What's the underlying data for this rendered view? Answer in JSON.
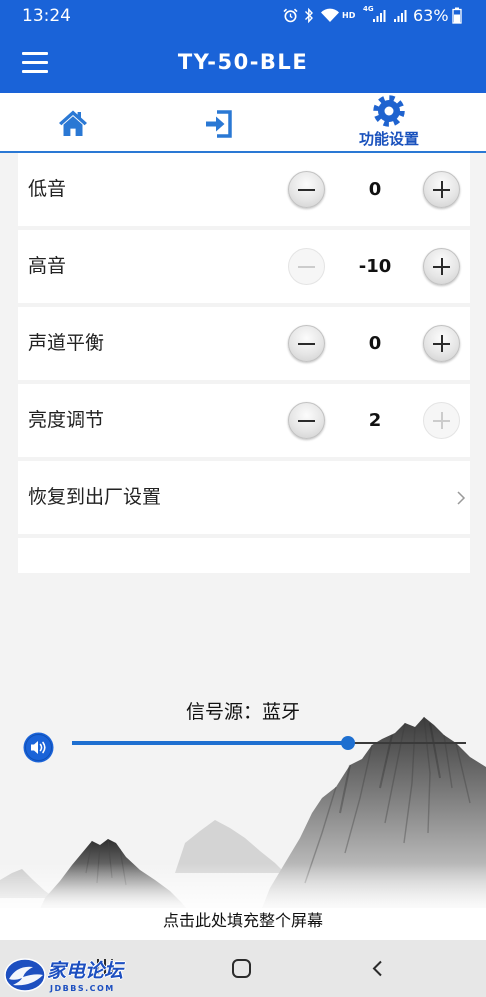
{
  "colors": {
    "primary": "#1a63d8",
    "tab_icon": "#2a78d4",
    "background": "#f3f3f3",
    "disabled": "#cccccc"
  },
  "status_bar": {
    "time": "13:24",
    "hd_label": "HD",
    "network_label": "4G",
    "battery": "63%",
    "icons": [
      "alarm-icon",
      "bluetooth-icon",
      "wifi-icon",
      "signal-icon",
      "signal-icon",
      "battery-icon"
    ]
  },
  "app_bar": {
    "menu_icon": "menu-icon",
    "title": "TY-50-BLE"
  },
  "tabs": [
    {
      "icon": "home-icon",
      "active": false
    },
    {
      "icon": "login-icon",
      "active": false
    },
    {
      "icon": "gear-icon",
      "label": "功能设置",
      "active": true
    }
  ],
  "settings": {
    "rows": [
      {
        "label": "低音",
        "value": "0",
        "minus_enabled": true,
        "plus_enabled": true
      },
      {
        "label": "高音",
        "value": "-10",
        "minus_enabled": false,
        "plus_enabled": true
      },
      {
        "label": "声道平衡",
        "value": "0",
        "minus_enabled": true,
        "plus_enabled": true
      },
      {
        "label": "亮度调节",
        "value": "2",
        "minus_enabled": true,
        "plus_enabled": false
      }
    ],
    "step_icons": [
      "minus-icon",
      "plus-icon"
    ],
    "reset": {
      "label": "恢复到出厂设置",
      "icon": "chevron-right-icon"
    }
  },
  "player": {
    "source": "信号源：蓝牙",
    "volume_icon": "volume-icon",
    "volume_level": 0.7
  },
  "fill_screen_hint": "点击此处填充整个屏幕",
  "nav_bar": {
    "icons": [
      "recent-apps-icon",
      "home-button-icon",
      "back-icon"
    ]
  },
  "watermark": {
    "name": "家电论坛",
    "site": "JDBBS.COM"
  }
}
